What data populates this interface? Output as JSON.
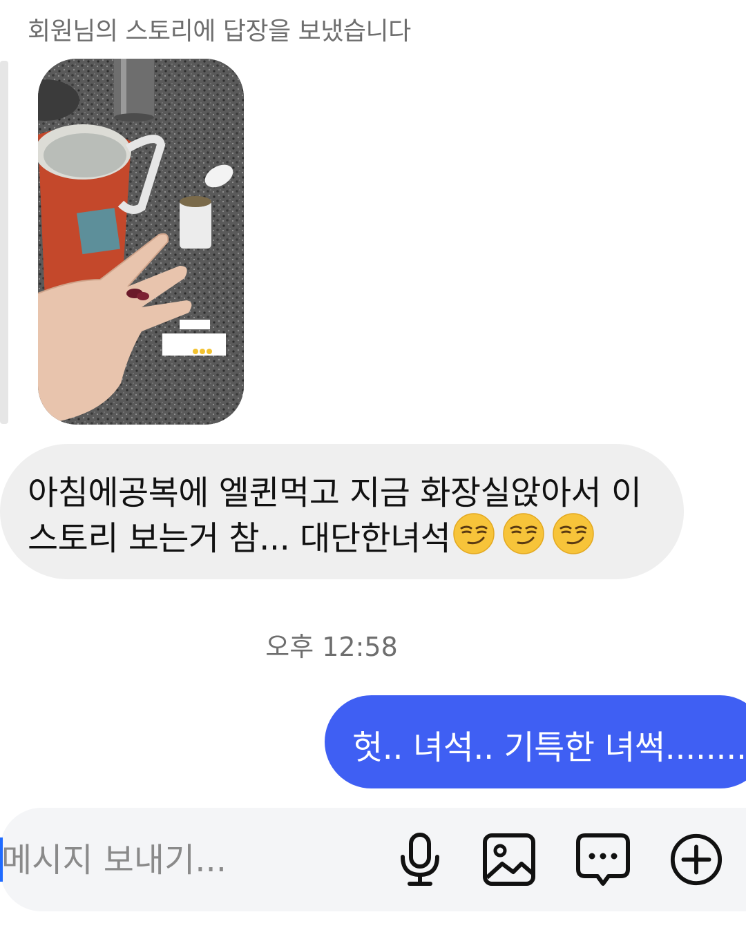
{
  "thread": {
    "story_reply_caption": "회원님의 스토리에 답장을 보냈습니다",
    "incoming_message": {
      "line1": "아침에공복에 엘퀸먹고 지금 화장실앉아서 이",
      "line2": "스토리 보는거 참... 대단한녀석",
      "emojis": [
        "smirking-face",
        "smirking-face",
        "smirking-face"
      ]
    },
    "timestamp": "오후 12:58",
    "outgoing_message": "헛.. 녀석.. 기특한 녀썩........"
  },
  "composer": {
    "placeholder": "메시지 보내기...",
    "icons": [
      "microphone-icon",
      "image-icon",
      "chat-bubble-icon",
      "add-icon"
    ]
  },
  "colors": {
    "incoming_bubble": "#efefef",
    "outgoing_bubble": "#3f5ff3",
    "secondary_text": "#6e6e6e",
    "composer_bg": "#f4f5f7"
  }
}
